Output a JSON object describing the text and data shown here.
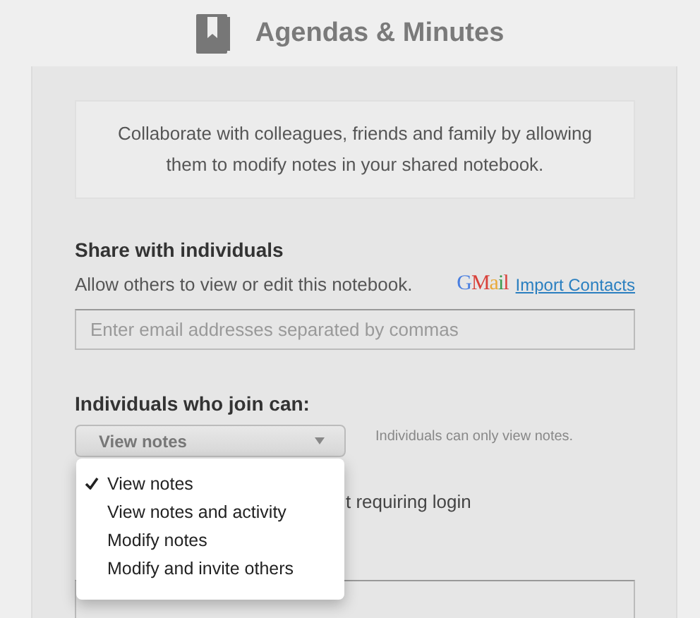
{
  "header": {
    "title": "Agendas & Minutes"
  },
  "intro": "Collaborate with colleagues, friends and family by allowing them to modify notes in your shared notebook.",
  "share": {
    "heading": "Share with individuals",
    "description": "Allow others to view or edit this notebook.",
    "gmail_logo": "GMail",
    "import_link": "Import Contacts",
    "email_field": {
      "placeholder": "Enter email addresses separated by commas"
    }
  },
  "permissions": {
    "heading": "Individuals who join can:",
    "select_value": "View notes",
    "hint": "Individuals can only view notes.",
    "expanded": true,
    "options": [
      {
        "label": "View notes",
        "selected": true
      },
      {
        "label": "View notes and activity",
        "selected": false
      },
      {
        "label": "Modify notes",
        "selected": false
      },
      {
        "label": "Modify and invite others",
        "selected": false
      }
    ]
  },
  "preview": {
    "label": "t requiring login"
  }
}
